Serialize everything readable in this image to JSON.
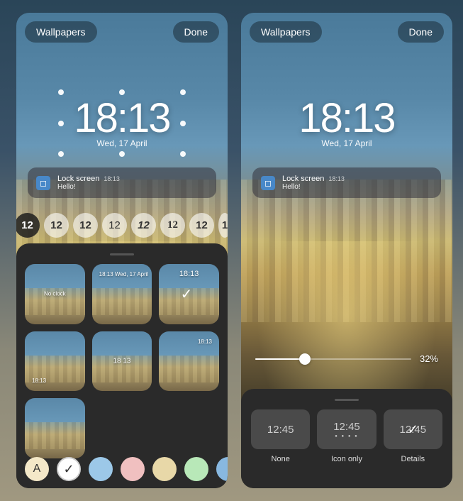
{
  "header": {
    "wallpapers_label": "Wallpapers",
    "done_label": "Done"
  },
  "clock": {
    "time": "18:13",
    "date": "Wed, 17 April"
  },
  "notification": {
    "app_name": "Lock screen",
    "time": "18:13",
    "text": "Hello!",
    "icon_glyph": "◻"
  },
  "font_options": [
    {
      "label": "12",
      "style": "dark selected"
    },
    {
      "label": "12",
      "style": "light"
    },
    {
      "label": "12",
      "style": "bold"
    },
    {
      "label": "12",
      "style": "thin"
    },
    {
      "label": "12",
      "style": "script"
    },
    {
      "label": "12",
      "style": "serif"
    },
    {
      "label": "12",
      "style": "outline"
    },
    {
      "label": "1",
      "style": "partial"
    }
  ],
  "layouts": [
    {
      "label": "No clock",
      "selected": false
    },
    {
      "label": "18:13 Wed, 17 April",
      "selected": false
    },
    {
      "label": "18:13",
      "selected": true
    },
    {
      "label": "18:13",
      "selected": false
    },
    {
      "label": "18 13",
      "selected": false
    },
    {
      "label": "18:13",
      "selected": false
    },
    {
      "label": "",
      "selected": false
    }
  ],
  "colors": [
    {
      "key": "letter-a",
      "hex": "#f4e8c8",
      "letter": "A"
    },
    {
      "key": "white-check",
      "hex": "#ffffff",
      "checked": true
    },
    {
      "key": "blue",
      "hex": "#9cc8e8"
    },
    {
      "key": "pink",
      "hex": "#f0c0c0"
    },
    {
      "key": "tan",
      "hex": "#e8d8a8"
    },
    {
      "key": "green",
      "hex": "#b8e8b8"
    },
    {
      "key": "blue2",
      "hex": "#88b8e0"
    }
  ],
  "slider": {
    "value_pct": 32,
    "value_label": "32%"
  },
  "noti_styles": [
    {
      "label": "None",
      "preview_time": "12:45",
      "selected": false
    },
    {
      "label": "Icon only",
      "preview_time": "12:45",
      "selected": false
    },
    {
      "label": "Details",
      "preview_time": "12:45",
      "selected": true
    }
  ]
}
